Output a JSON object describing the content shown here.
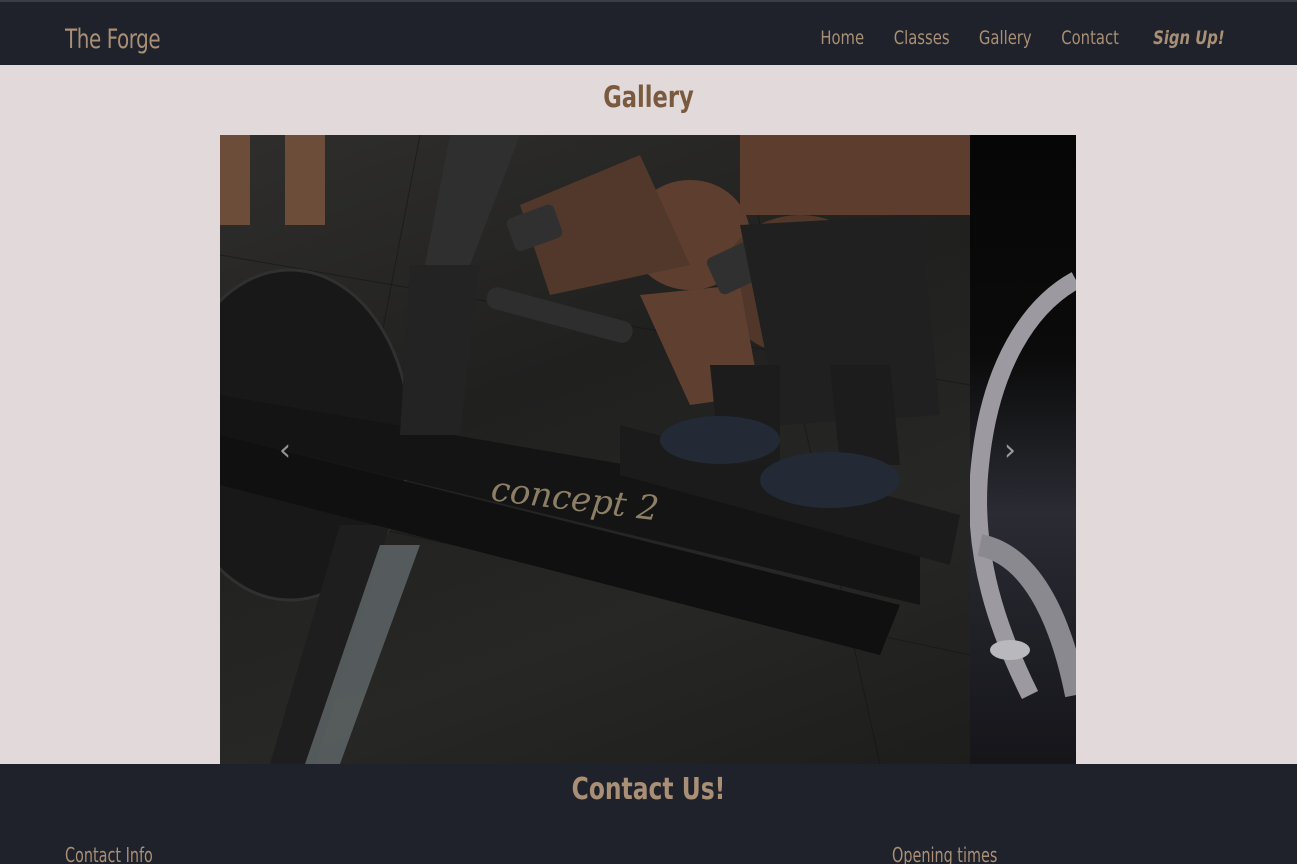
{
  "navbar": {
    "brand": "The Forge",
    "links": [
      {
        "label": "Home"
      },
      {
        "label": "Classes"
      },
      {
        "label": "Gallery"
      },
      {
        "label": "Contact"
      },
      {
        "label": "Sign Up!"
      }
    ]
  },
  "gallery": {
    "title": "Gallery",
    "slide_text": "concept 2",
    "prev_icon": "chevron-left-icon",
    "next_icon": "chevron-right-icon"
  },
  "footer": {
    "title": "Contact Us!",
    "contact_info": "Contact Info",
    "opening_times": "Opening times"
  },
  "colors": {
    "navbar_bg": "#1f222b",
    "page_bg": "#e1d9da",
    "accent": "#a88f75",
    "heading": "#7a5a3e"
  }
}
